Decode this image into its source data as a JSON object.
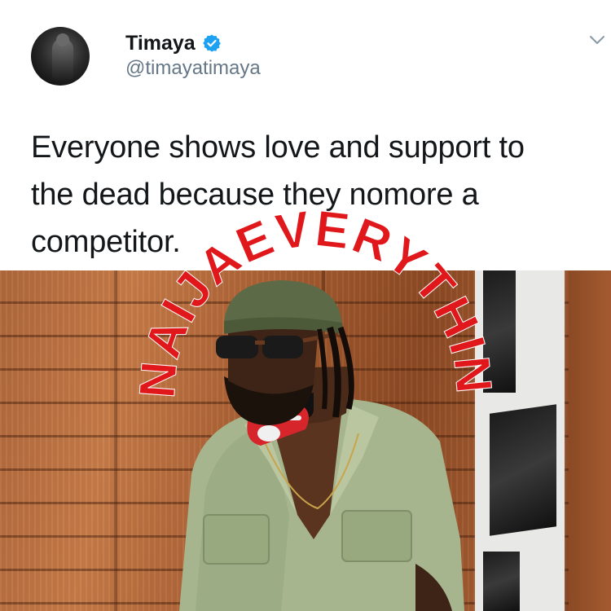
{
  "tweet": {
    "display_name": "Timaya",
    "handle": "@timayatimaya",
    "text_lines": [
      "Everyone shows love and support to",
      "the dead because they nomore a",
      "competitor."
    ],
    "verified": true
  },
  "icons": {
    "verified": "verified-badge-icon",
    "more": "chevron-down-icon"
  },
  "watermark": {
    "text": "NAIJAEVERYTHING",
    "color": "#e0181b"
  },
  "colors": {
    "name": "#14171a",
    "handle": "#657786",
    "verified_blue": "#1da1f2"
  }
}
